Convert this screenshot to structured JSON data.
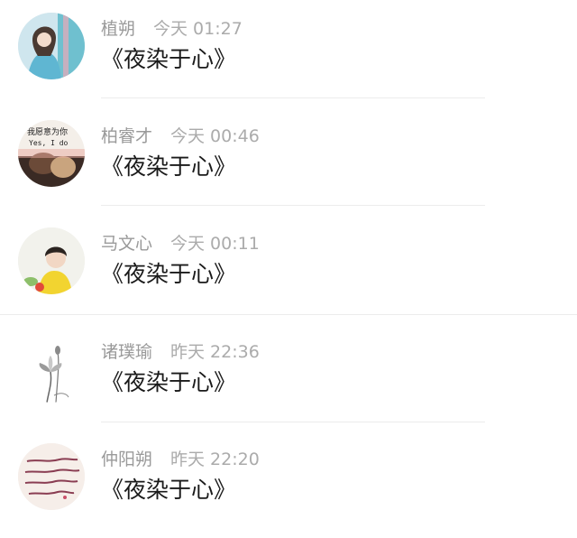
{
  "comments": [
    {
      "name": "植朔",
      "time": "今天 01:27",
      "text": "《夜染于心》",
      "avatar": "girl-blue-avatar"
    },
    {
      "name": "柏睿才",
      "time": "今天 00:46",
      "text": "《夜染于心》",
      "avatar": "yes-i-do-avatar",
      "avatar_text_1": "我愿意为你",
      "avatar_text_2": "Yes, I do"
    },
    {
      "name": "马文心",
      "time": "今天 00:11",
      "text": "《夜染于心》",
      "avatar": "boy-yellow-avatar"
    },
    {
      "name": "诸璞瑜",
      "time": "昨天 22:36",
      "text": "《夜染于心》",
      "avatar": "lotus-avatar"
    },
    {
      "name": "仲阳朔",
      "time": "昨天 22:20",
      "text": "《夜染于心》",
      "avatar": "handwriting-avatar"
    }
  ]
}
